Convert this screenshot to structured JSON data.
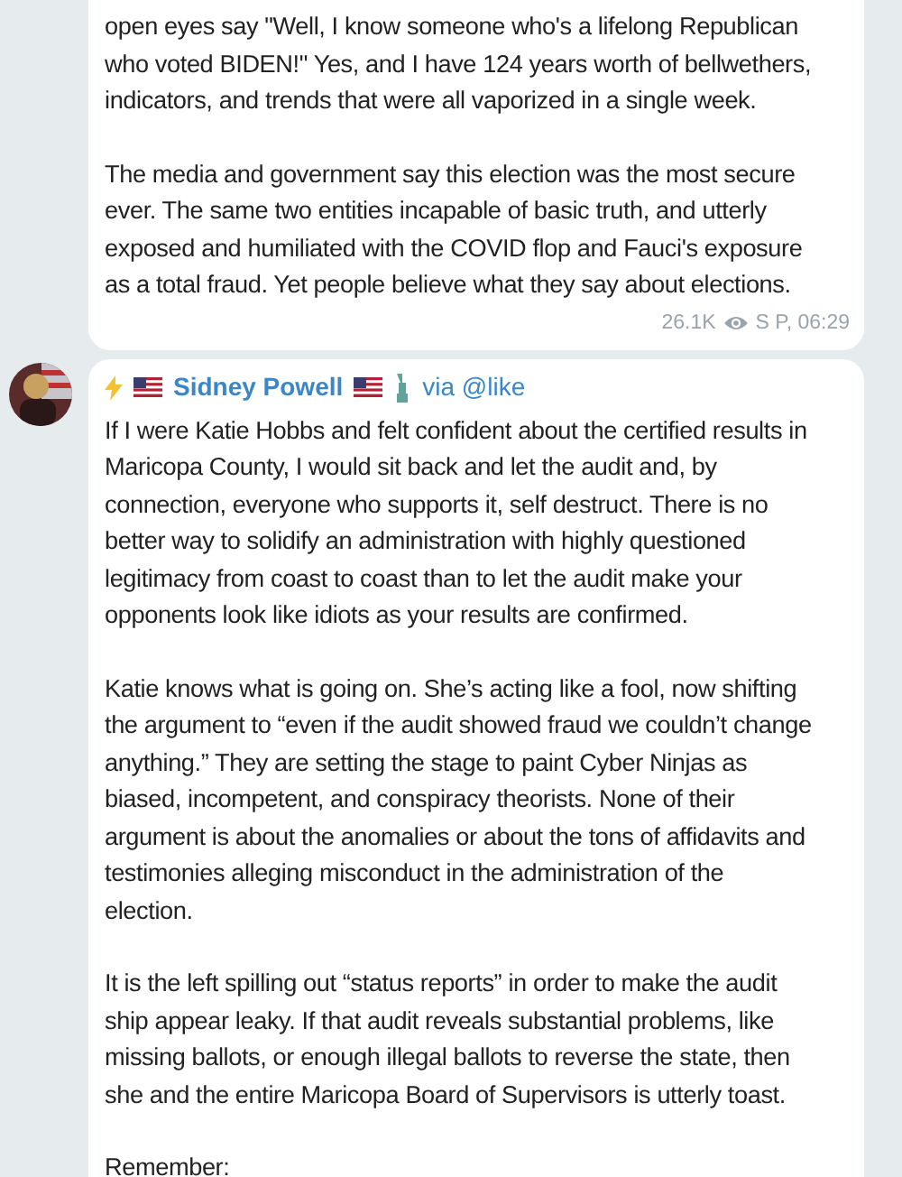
{
  "posts": [
    {
      "paragraphs": [
        [
          "open eyes say \"Well, I know someone who's a lifelong Republican",
          "who voted BIDEN!\" Yes, and I have 124 years worth of bellwethers,",
          "indicators, and trends that were all vaporized in a single week."
        ],
        [
          "The media and government say this election was the most secure",
          "ever. The same two entities incapable of basic truth, and utterly",
          "exposed and humiliated with the COVID flop and Fauci's exposure",
          "as a total fraud. Yet people believe what they say about elections."
        ]
      ],
      "views": "26.1K",
      "time": "S P, 06:29"
    },
    {
      "author": "Sidney Powell",
      "via": "via @like",
      "paragraphs": [
        [
          "If I were Katie Hobbs and felt confident about the certified results in",
          "Maricopa County, I would sit back and let the audit and, by",
          "connection, everyone who supports it, self destruct. There is no",
          "better way to solidify an administration with highly questioned",
          "legitimacy from coast to coast than to let the audit make your",
          "opponents look like idiots as your results are confirmed."
        ],
        [
          "Katie knows what is going on. She’s acting like a fool, now shifting",
          "the argument to “even if the audit showed fraud we couldn’t change",
          "anything.” They are setting the stage to paint Cyber Ninjas as",
          "biased, incompetent, and conspiracy theorists. None of their",
          "argument is about the anomalies or about the tons of affidavits and",
          "testimonies alleging misconduct in the administration of the",
          "election."
        ],
        [
          "It is the left spilling out “status reports” in order to make the audit",
          "ship appear leaky. If that audit reveals substantial problems, like",
          "missing ballots, or enough illegal ballots to reverse the state, then",
          "she and the entire Maricopa Board of Supervisors is utterly toast."
        ],
        [
          "Remember:"
        ]
      ]
    }
  ]
}
